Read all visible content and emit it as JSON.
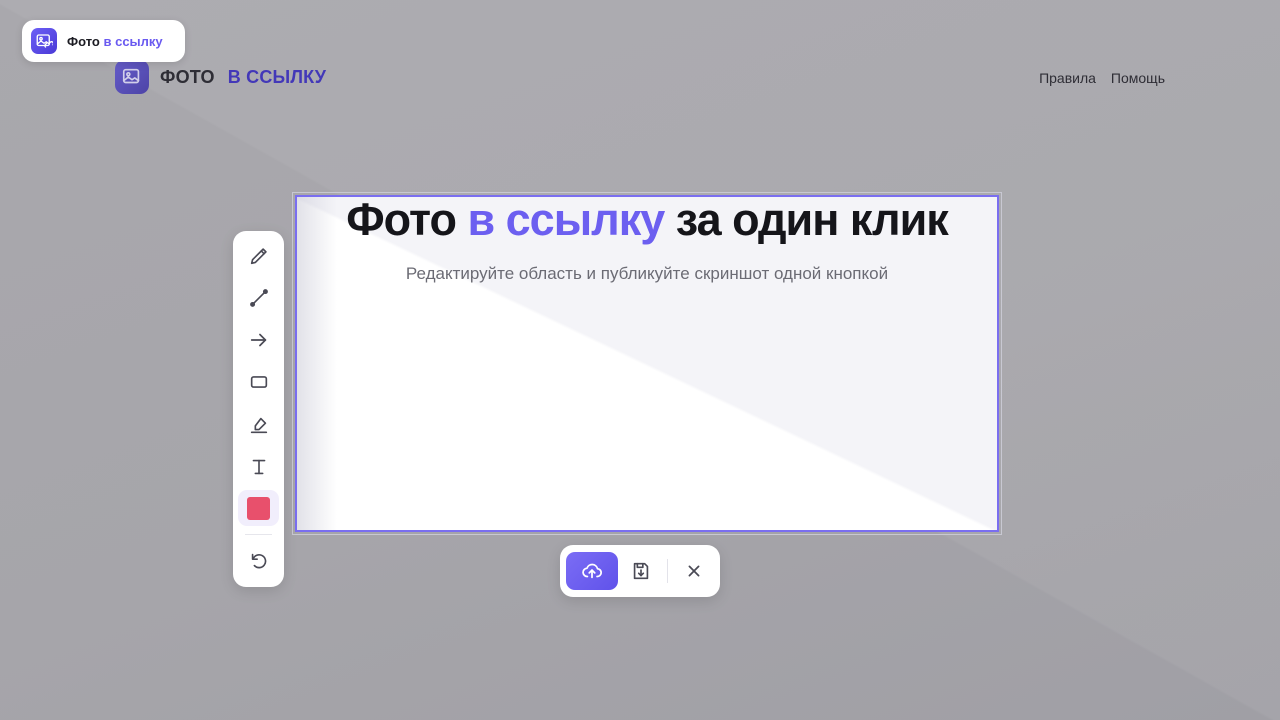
{
  "extension_badge": {
    "label_part1": "Фото",
    "label_part2": "в ссылку",
    "icon": "image-link-icon"
  },
  "site": {
    "logo_part1": "ФОТО",
    "logo_part2": "В ССЫЛКУ",
    "logo_icon": "image-link-icon",
    "nav": [
      {
        "label": "Правила"
      },
      {
        "label": "Помощь"
      }
    ]
  },
  "hero": {
    "title_part1": "Фото",
    "title_part2": "в ссылку",
    "title_part3": "за один клик",
    "subtitle": "Редактируйте область и публикуйте скриншот одной кнопкой"
  },
  "toolbar": {
    "tools": [
      {
        "name": "pencil-tool",
        "icon": "pencil-icon"
      },
      {
        "name": "line-tool",
        "icon": "line-icon"
      },
      {
        "name": "arrow-tool",
        "icon": "arrow-right-icon"
      },
      {
        "name": "rectangle-tool",
        "icon": "rectangle-icon"
      },
      {
        "name": "marker-tool",
        "icon": "marker-icon"
      },
      {
        "name": "text-tool",
        "icon": "text-cursor-icon"
      },
      {
        "name": "color-picker",
        "icon": "color-swatch"
      },
      {
        "name": "undo-button",
        "icon": "undo-icon"
      }
    ],
    "active_color": "#e8506c"
  },
  "actions": [
    {
      "name": "upload-button",
      "icon": "cloud-upload-icon"
    },
    {
      "name": "save-button",
      "icon": "save-download-icon"
    },
    {
      "name": "close-button",
      "icon": "close-icon"
    }
  ],
  "colors": {
    "accent": "#6c5ff0",
    "selection_border": "#7a6ef0"
  }
}
